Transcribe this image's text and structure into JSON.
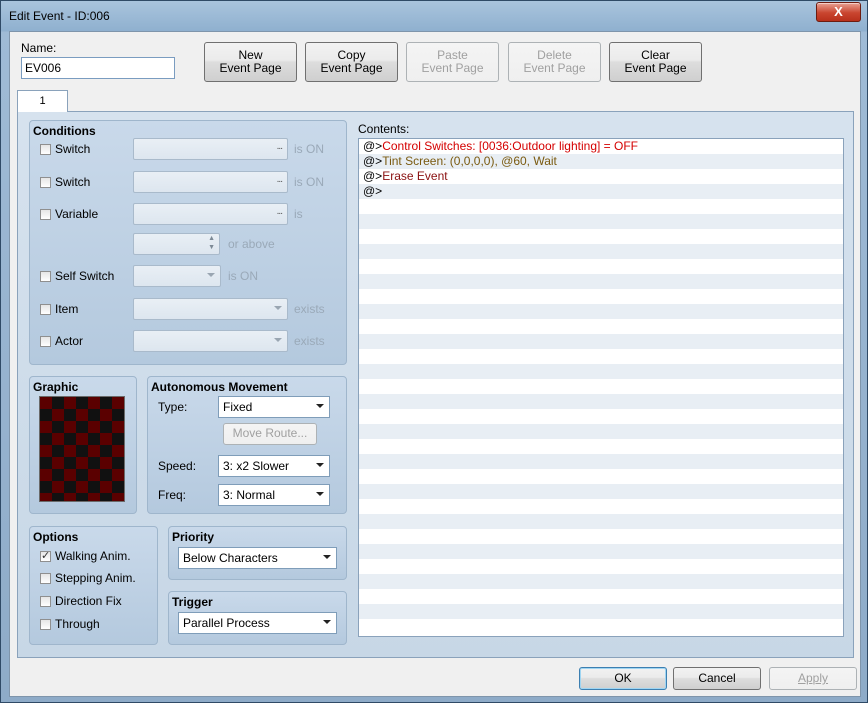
{
  "window": {
    "title": "Edit Event - ID:006",
    "close_label": "X"
  },
  "name": {
    "label": "Name:",
    "value": "EV006"
  },
  "toolbar": {
    "new": [
      "New",
      "Event Page"
    ],
    "copy": [
      "Copy",
      "Event Page"
    ],
    "paste": [
      "Paste",
      "Event Page"
    ],
    "delete": [
      "Delete",
      "Event Page"
    ],
    "clear": [
      "Clear",
      "Event Page"
    ]
  },
  "tabs": [
    {
      "label": "1"
    }
  ],
  "conditions": {
    "title": "Conditions",
    "switch1": {
      "label": "Switch",
      "suffix": "is ON"
    },
    "switch2": {
      "label": "Switch",
      "suffix": "is ON"
    },
    "variable": {
      "label": "Variable",
      "suffix": "is",
      "above": "or above"
    },
    "self_switch": {
      "label": "Self Switch",
      "suffix": "is ON"
    },
    "item": {
      "label": "Item",
      "suffix": "exists"
    },
    "actor": {
      "label": "Actor",
      "suffix": "exists"
    },
    "ellipsis": "..."
  },
  "graphic": {
    "title": "Graphic"
  },
  "movement": {
    "title": "Autonomous Movement",
    "type_label": "Type:",
    "type_value": "Fixed",
    "move_route": "Move Route...",
    "speed_label": "Speed:",
    "speed_value": "3: x2 Slower",
    "freq_label": "Freq:",
    "freq_value": "3: Normal"
  },
  "options": {
    "title": "Options",
    "walking": {
      "label": "Walking Anim.",
      "checked": true
    },
    "stepping": {
      "label": "Stepping Anim.",
      "checked": false
    },
    "direction_fix": {
      "label": "Direction Fix",
      "checked": false
    },
    "through": {
      "label": "Through",
      "checked": false
    }
  },
  "priority": {
    "title": "Priority",
    "value": "Below Characters"
  },
  "trigger": {
    "title": "Trigger",
    "value": "Parallel Process"
  },
  "contents": {
    "label": "Contents:",
    "prefix": "@>",
    "lines": [
      {
        "text": "Control Switches: [0036:Outdoor lighting] = OFF",
        "color": "#d40000"
      },
      {
        "text": "Tint Screen: (0,0,0,0), @60, Wait",
        "color": "#7a5a10"
      },
      {
        "text": "Erase Event",
        "color": "#8a1010"
      },
      {
        "text": "",
        "color": "#000000"
      }
    ]
  },
  "footer": {
    "ok": "OK",
    "cancel": "Cancel",
    "apply": "Apply"
  }
}
